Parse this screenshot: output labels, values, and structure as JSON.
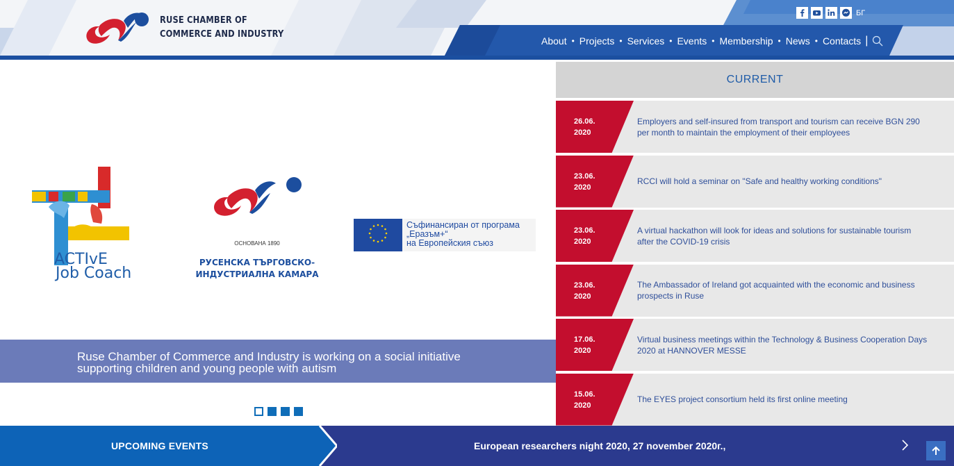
{
  "header": {
    "org_line1": "RUSE CHAMBER OF",
    "org_line2": "COMMERCE AND INDUSTRY",
    "social": [
      "facebook-icon",
      "youtube-icon",
      "linkedin-icon",
      "messenger-icon"
    ],
    "lang": "БГ",
    "nav": [
      "About",
      "Projects",
      "Services",
      "Events",
      "Membership",
      "News",
      "Contacts"
    ]
  },
  "slider": {
    "active_logo": {
      "line1": "ACTIvE",
      "line2": "Job Coach"
    },
    "rcci_logo": {
      "founded": "ОСНОВАНА 1890",
      "line1": "РУСЕНСКА ТЪРГОВСКО-",
      "line2": "ИНДУСТРИАЛНА КАМАРА"
    },
    "eu_logo": {
      "line1": "Съфинансиран от програма",
      "line2": "„Еразъм+“",
      "line3": "на Европейския съюз"
    },
    "caption_line1": "Ruse Chamber of Commerce and Industry is working on a social initiative",
    "caption_line2": "supporting children and young people with autism",
    "dots": 4,
    "active_dot": 0
  },
  "news": {
    "heading": "CURRENT",
    "items": [
      {
        "date1": "26.06.",
        "date2": "2020",
        "title": "Employers and self-insured from transport and tourism can receive BGN 290 per month to maintain the employment of their employees"
      },
      {
        "date1": "23.06.",
        "date2": "2020",
        "title": "RCCI will hold a seminar on \"Safe and healthy working conditions\""
      },
      {
        "date1": "23.06.",
        "date2": "2020",
        "title": "A virtual hackathon will look for ideas and solutions for sustainable tourism after the COVID-19 crisis"
      },
      {
        "date1": "23.06.",
        "date2": "2020",
        "title": "The Ambassador of Ireland got acquainted with the economic and business prospects in Ruse"
      },
      {
        "date1": "17.06.",
        "date2": "2020",
        "title": "Virtual business meetings within the Technology & Business Cooperation Days 2020 at HANNOVER MESSE"
      },
      {
        "date1": "15.06.",
        "date2": "2020",
        "title": "The EYES project consortium held its first online meeting"
      }
    ]
  },
  "bottom": {
    "upcoming_label": "UPCOMING EVENTS",
    "event_title": "European researchers night 2020, 27 november 2020г.,"
  },
  "colors": {
    "brand_blue": "#1b4fa0",
    "brand_red": "#c30e2e",
    "caption_bg": "#6b7bb9",
    "news_text": "#2f4f9a"
  }
}
